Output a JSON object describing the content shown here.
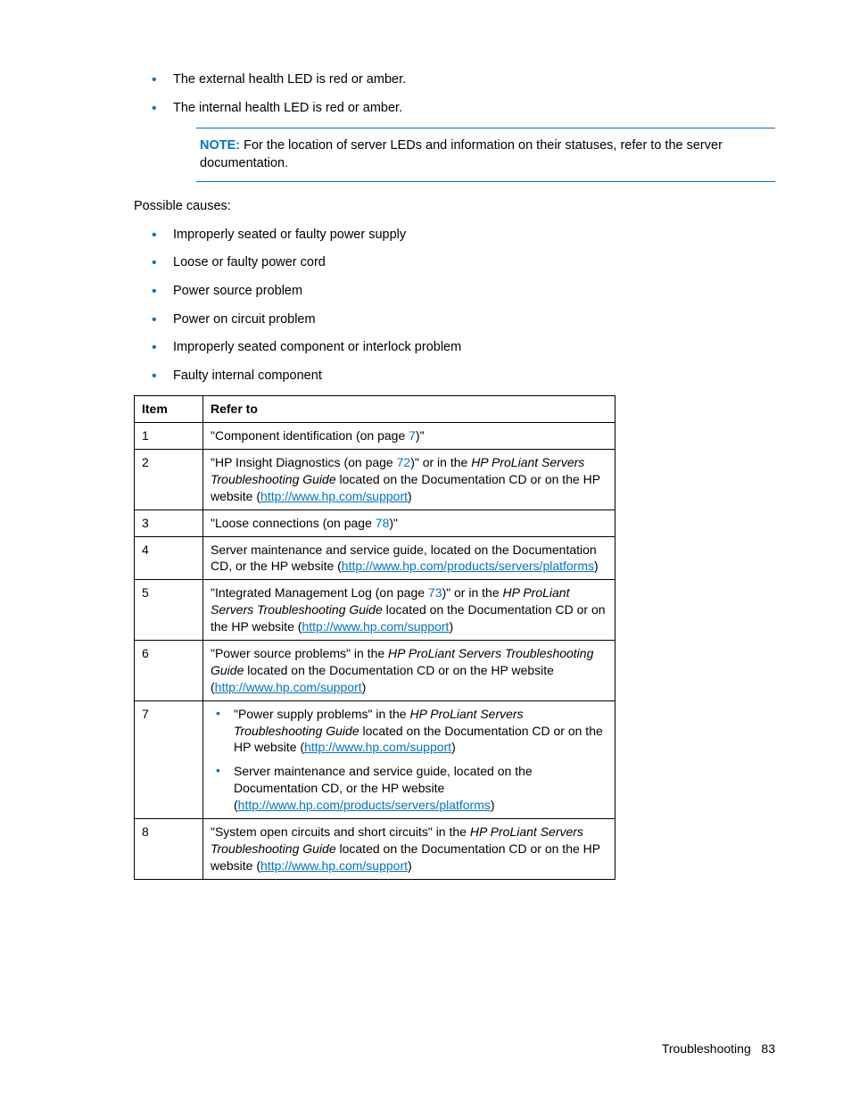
{
  "top_bullets": [
    "The external health LED is red or amber.",
    "The internal health LED is red or amber."
  ],
  "note": {
    "label": "NOTE:",
    "text": "  For the location of server LEDs and information on their statuses, refer to the server documentation."
  },
  "causes_label": "Possible causes:",
  "causes": [
    "Improperly seated or faulty power supply",
    "Loose or faulty power cord",
    "Power source problem",
    "Power on circuit problem",
    "Improperly seated component or interlock problem",
    "Faulty internal component"
  ],
  "table": {
    "headers": [
      "Item",
      "Refer to"
    ],
    "rows": {
      "r1_item": "1",
      "r1_a": "\"Component identification (on page ",
      "r1_page": "7",
      "r1_b": ")\"",
      "r2_item": "2",
      "r2_a": "\"HP Insight Diagnostics (on page ",
      "r2_page": "72",
      "r2_b": ")\" or in the ",
      "r2_it": "HP ProLiant Servers Troubleshooting Guide",
      "r2_c": " located on the Documentation CD or on the HP website (",
      "r2_link": "http://www.hp.com/support",
      "r2_d": ")",
      "r3_item": "3",
      "r3_a": "\"Loose connections (on page ",
      "r3_page": "78",
      "r3_b": ")\"",
      "r4_item": "4",
      "r4_a": "Server maintenance and service guide, located on the Documentation CD, or the HP website (",
      "r4_link": "http://www.hp.com/products/servers/platforms",
      "r4_b": ")",
      "r5_item": "5",
      "r5_a": "\"Integrated Management Log (on page ",
      "r5_page": "73",
      "r5_b": ")\" or in the ",
      "r5_it": "HP ProLiant Servers Troubleshooting Guide",
      "r5_c": " located on the Documentation CD or on the HP website (",
      "r5_link": "http://www.hp.com/support",
      "r5_d": ")",
      "r6_item": "6",
      "r6_a": "\"Power source problems\" in the ",
      "r6_it": "HP ProLiant Servers Troubleshooting Guide",
      "r6_b": " located on the Documentation CD or on the HP website (",
      "r6_link": "http://www.hp.com/support",
      "r6_c": ")",
      "r7_item": "7",
      "r7_s1_a": "\"Power supply problems\" in the ",
      "r7_s1_it": "HP ProLiant Servers Troubleshooting Guide",
      "r7_s1_b": " located on the Documentation CD or on the HP website (",
      "r7_s1_link": "http://www.hp.com/support",
      "r7_s1_c": ")",
      "r7_s2_a": "Server maintenance and service guide, located on the Documentation CD, or the HP website (",
      "r7_s2_link": "http://www.hp.com/products/servers/platforms",
      "r7_s2_b": ")",
      "r8_item": "8",
      "r8_a": "\"System open circuits and short circuits\" in the ",
      "r8_it": "HP ProLiant Servers Troubleshooting Guide",
      "r8_b": " located on the Documentation CD or on the HP website (",
      "r8_link": "http://www.hp.com/support",
      "r8_c": ")"
    }
  },
  "footer": {
    "section": "Troubleshooting",
    "page": "83"
  }
}
